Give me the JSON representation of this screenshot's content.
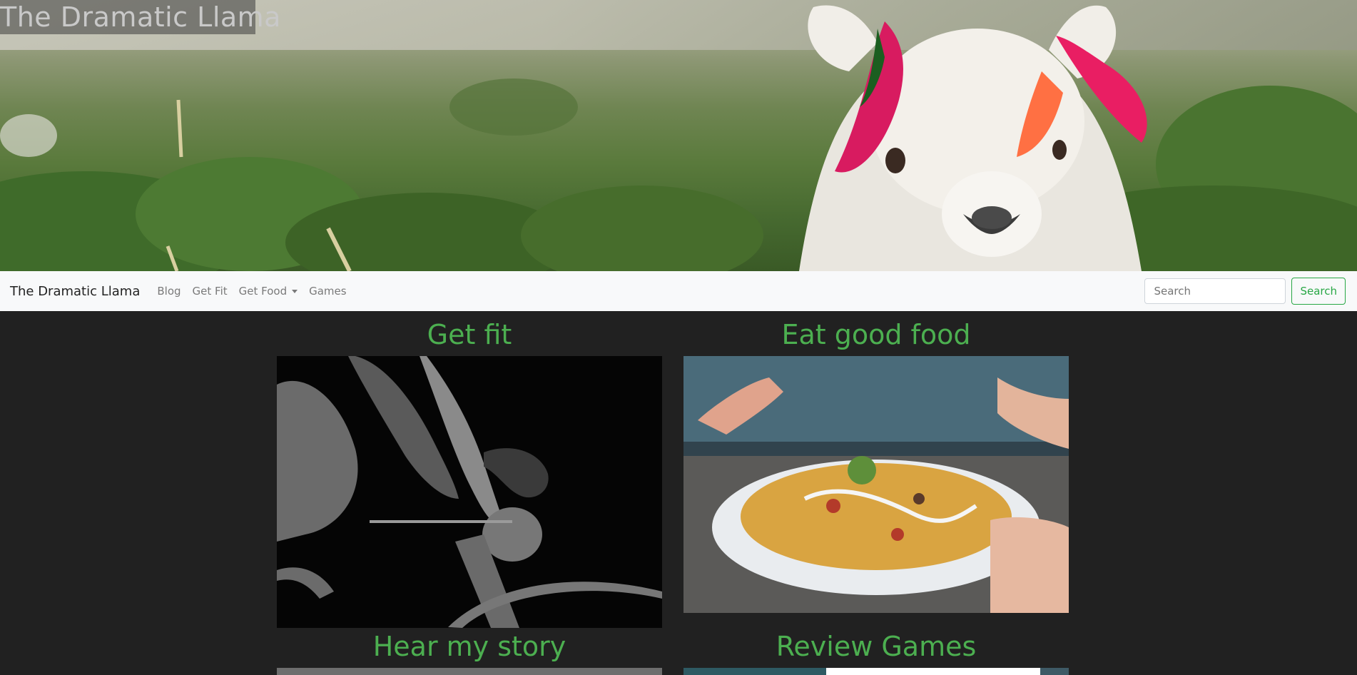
{
  "hero": {
    "title": "The Dramatic Llama"
  },
  "navbar": {
    "brand": "The Dramatic Llama",
    "links": [
      "Blog",
      "Get Fit",
      "Get Food",
      "Games"
    ],
    "search_placeholder": "Search",
    "search_button": "Search"
  },
  "cards": [
    {
      "title": "Get fit"
    },
    {
      "title": "Eat good food"
    },
    {
      "title": "Hear my story"
    },
    {
      "title": "Review Games"
    }
  ],
  "colors": {
    "accent_green": "#4caf50",
    "button_green": "#28a745",
    "page_bg": "#212121",
    "navbar_bg": "#f8f9fa"
  }
}
